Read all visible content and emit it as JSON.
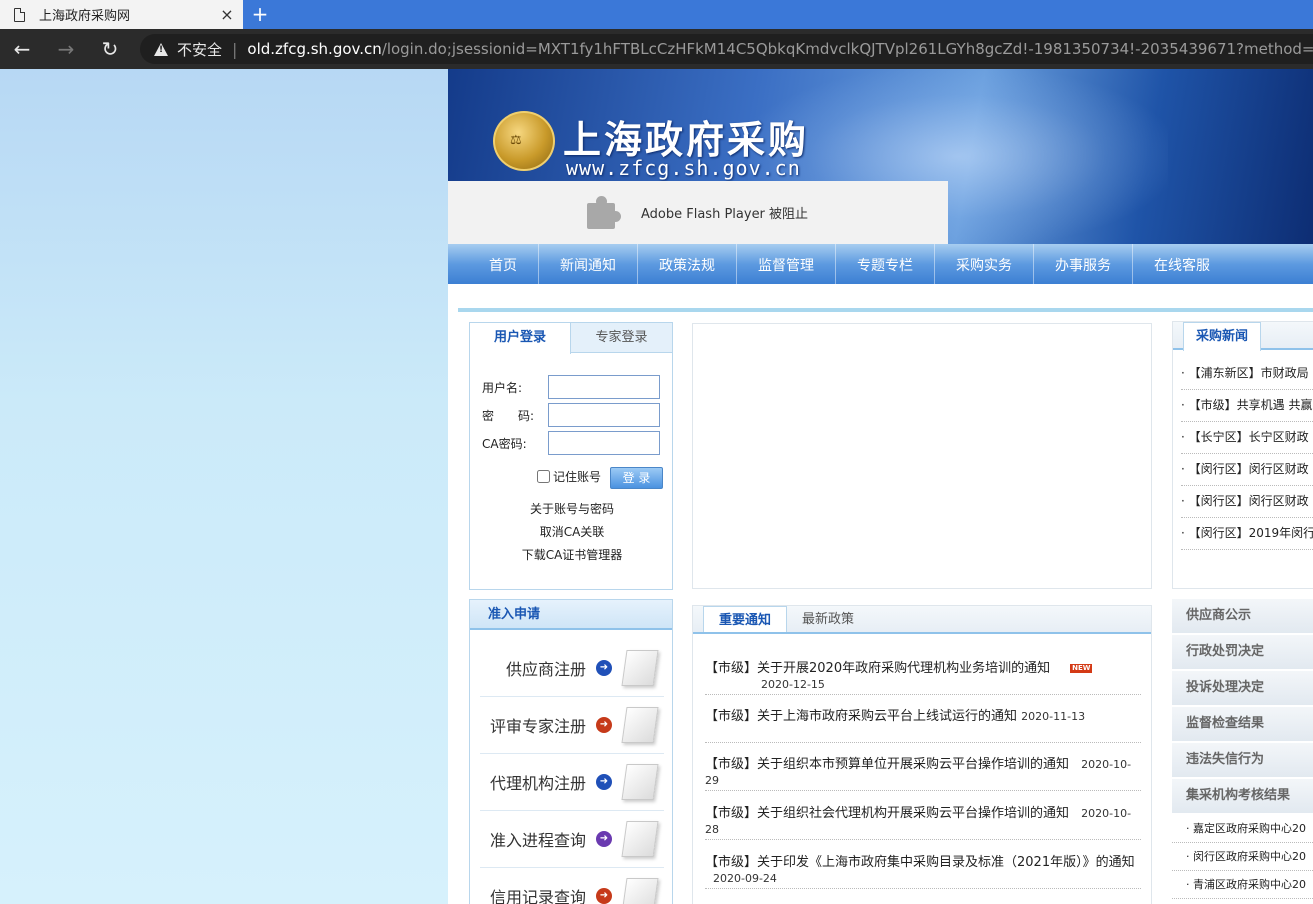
{
  "browser": {
    "tab_title": "上海政府采购网",
    "tab_close": "×",
    "new_tab": "+",
    "insecure_label": "不安全",
    "url_host": "old.zfcg.sh.gov.cn",
    "url_rest": "/login.do;jsessionid=MXT1fy1hFTBLcCzHFkM14C5QbkqKmdvclkQJTVpl261LGYh8gcZd!-1981350734!-2035439671?method=beginlogin"
  },
  "header": {
    "site_title": "上海政府采购",
    "site_url": "www.zfcg.sh.gov.cn",
    "flash_notice": "Adobe Flash Player 被阻止"
  },
  "nav": [
    "首页",
    "新闻通知",
    "政策法规",
    "监督管理",
    "专题专栏",
    "采购实务",
    "办事服务",
    "在线客服"
  ],
  "login": {
    "tab_user": "用户登录",
    "tab_expert": "专家登录",
    "username_label": "用户名:",
    "password_label": "密　　码:",
    "ca_label": "CA密码:",
    "remember_label": "记住账号",
    "submit": "登 录",
    "links": [
      "关于账号与密码",
      "取消CA关联",
      "下载CA证书管理器"
    ]
  },
  "registration": {
    "title": "准入申请",
    "items": [
      {
        "label": "供应商注册",
        "color": "#2050b8"
      },
      {
        "label": "评审专家注册",
        "color": "#c63a1a"
      },
      {
        "label": "代理机构注册",
        "color": "#2050b8"
      },
      {
        "label": "准入进程查询",
        "color": "#6a3ab0"
      },
      {
        "label": "信用记录查询",
        "color": "#c63a1a"
      }
    ]
  },
  "notices": {
    "tab_important": "重要通知",
    "tab_policy": "最新政策",
    "new_badge": "NEW",
    "items": [
      {
        "title": "【市级】关于开展2020年政府采购代理机构业务培训的通知",
        "date": "2020-12-15"
      },
      {
        "title": "【市级】关于上海市政府采购云平台上线试运行的通知",
        "date": "2020-11-13"
      },
      {
        "title": "【市级】关于组织本市预算单位开展采购云平台操作培训的通知",
        "date": "2020-10-29"
      },
      {
        "title": "【市级】关于组织社会代理机构开展采购云平台操作培训的通知",
        "date": "2020-10-28"
      },
      {
        "title": "【市级】关于印发《上海市政府集中采购目录及标准（2021年版）》的通知",
        "date": "2020-09-24"
      }
    ]
  },
  "news": {
    "title": "采购新闻",
    "items": [
      "· 【浦东新区】市财政局",
      "· 【市级】共享机遇 共赢",
      "· 【长宁区】长宁区财政",
      "· 【闵行区】闵行区财政",
      "· 【闵行区】闵行区财政",
      "· 【闵行区】2019年闵行"
    ]
  },
  "sidebar": {
    "items": [
      "供应商公示",
      "行政处罚决定",
      "投诉处理决定",
      "监督检查结果",
      "违法失信行为",
      "集采机构考核结果"
    ],
    "sub_items": [
      "· 嘉定区政府采购中心20",
      "· 闵行区政府采购中心20",
      "· 青浦区政府采购中心20"
    ]
  }
}
